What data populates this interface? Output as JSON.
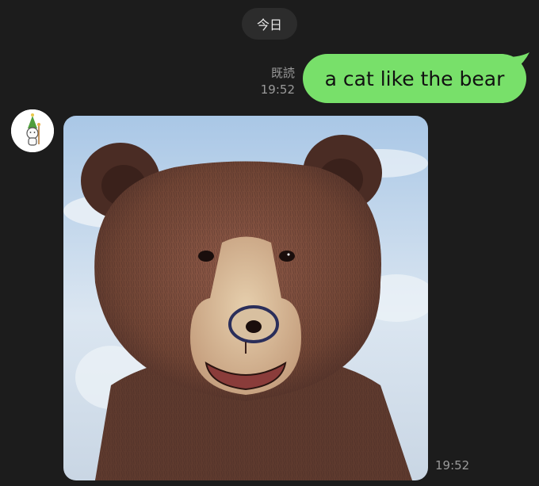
{
  "date_separator": "今日",
  "outgoing": {
    "read_label": "既読",
    "time": "19:52",
    "text": "a cat like the bear"
  },
  "incoming": {
    "sender_avatar": "rabbit-wizard-sticker",
    "image_subject": "bear-photo",
    "time": "19:52"
  },
  "colors": {
    "background": "#1c1c1c",
    "outgoing_bubble": "#78e06a",
    "meta_text": "#9a9a9a",
    "date_pill": "#2c2c2c"
  }
}
